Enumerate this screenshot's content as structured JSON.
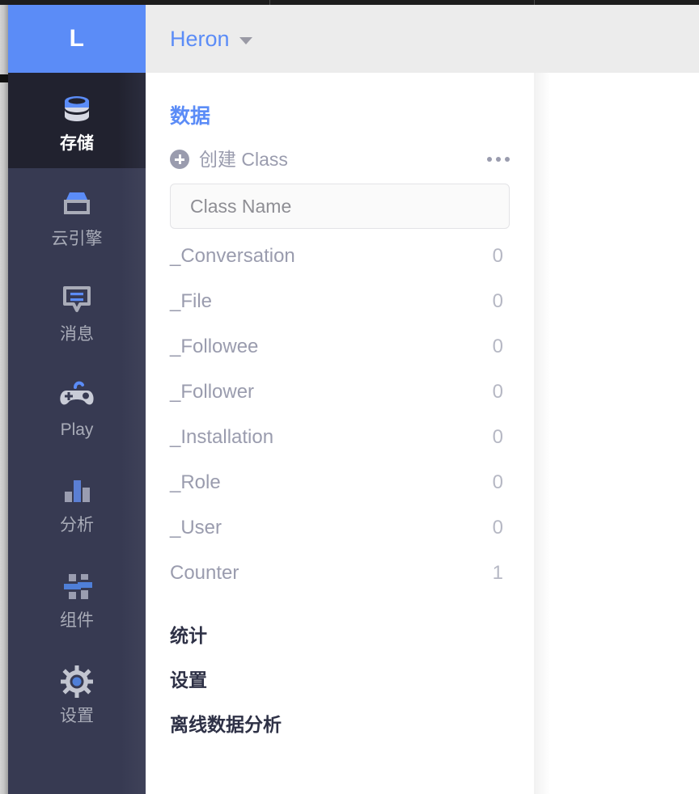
{
  "colors": {
    "accent_blue": "#5b8cf7",
    "sidebar_bg": "#373a52",
    "sidebar_active_bg": "#21222f",
    "header_bg": "#ececec",
    "muted_text": "#9a9cae",
    "heading_dark": "#2e3146"
  },
  "logo": {
    "letter": "L"
  },
  "header": {
    "app_name": "Heron",
    "caret_icon": "chevron-down-icon"
  },
  "sidebar": {
    "items": [
      {
        "label": "存储",
        "icon": "database-icon",
        "active": true
      },
      {
        "label": "云引擎",
        "icon": "server-box-icon",
        "active": false
      },
      {
        "label": "消息",
        "icon": "chat-bubble-icon",
        "active": false
      },
      {
        "label": "Play",
        "icon": "gamepad-icon",
        "active": false
      },
      {
        "label": "分析",
        "icon": "bar-chart-icon",
        "active": false
      },
      {
        "label": "组件",
        "icon": "sliders-icon",
        "active": false
      },
      {
        "label": "设置",
        "icon": "gear-icon",
        "active": false
      }
    ]
  },
  "class_panel": {
    "title": "数据",
    "create_label": "创建 Class",
    "plus_icon": "plus-circle-icon",
    "more_icon": "ellipsis-icon",
    "input_placeholder": "Class Name",
    "input_value": "",
    "classes": [
      {
        "name": "_Conversation",
        "count": "0"
      },
      {
        "name": "_File",
        "count": "0"
      },
      {
        "name": "_Followee",
        "count": "0"
      },
      {
        "name": "_Follower",
        "count": "0"
      },
      {
        "name": "_Installation",
        "count": "0"
      },
      {
        "name": "_Role",
        "count": "0"
      },
      {
        "name": "_User",
        "count": "0"
      },
      {
        "name": "Counter",
        "count": "1"
      }
    ],
    "sections": [
      {
        "label": "统计"
      },
      {
        "label": "设置"
      },
      {
        "label": "离线数据分析"
      }
    ]
  }
}
